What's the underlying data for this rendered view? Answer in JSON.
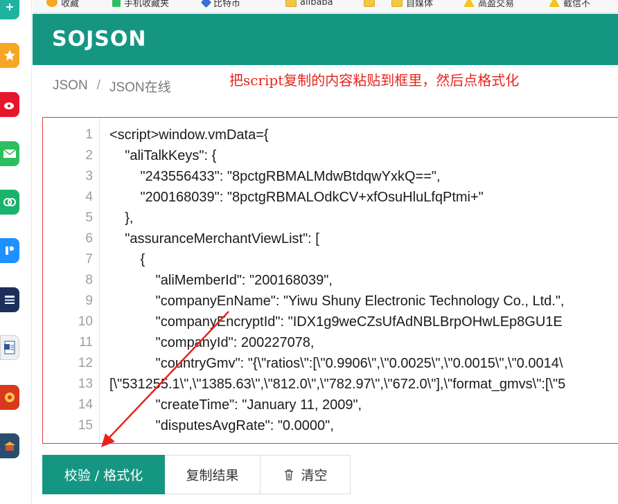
{
  "bookmarks": [
    {
      "label": "收藏",
      "icon": "star-icon"
    },
    {
      "label": "手机收藏夹",
      "icon": "folder-icon"
    },
    {
      "label": "比特币",
      "icon": "folder-icon"
    },
    {
      "label": "alibaba",
      "icon": "folder-icon"
    },
    {
      "label": "",
      "icon": "folder-icon"
    },
    {
      "label": "自媒体",
      "icon": "folder-icon"
    },
    {
      "label": "高盈交易",
      "icon": "warning-icon"
    },
    {
      "label": "截信不",
      "icon": "warning-icon"
    }
  ],
  "header": {
    "logo": "SOJSON",
    "color": "#159683"
  },
  "breadcrumb": {
    "items": [
      "JSON",
      "JSON在线"
    ],
    "separator": "/"
  },
  "annotation": "把script复制的内容粘贴到框里，然后点格式化",
  "editor": {
    "line_numbers": [
      "1",
      "2",
      "3",
      "4",
      "5",
      "6",
      "7",
      "8",
      "9",
      "10",
      "11",
      "12",
      "13",
      "14",
      "15"
    ],
    "lines": [
      "<script>window.vmData={",
      "    \"aliTalkKeys\": {",
      "        \"243556433\": \"8pctgRBMALMdwBtdqwYxkQ==\",",
      "        \"200168039\": \"8pctgRBMALOdkCV+xfOsuHluLfqPtmi+\"",
      "    },",
      "    \"assuranceMerchantViewList\": [",
      "        {",
      "            \"aliMemberId\": \"200168039\",",
      "            \"companyEnName\": \"Yiwu Shuny Electronic Technology Co., Ltd.\",",
      "            \"companyEncryptId\": \"IDX1g9weCZsUfAdNBLBrpOHwLEp8GU1E",
      "            \"companyId\": 200227078,",
      "            \"countryGmv\": \"{\\\"ratios\\\":[\\\"0.9906\\\",\\\"0.0025\\\",\\\"0.0015\\\",\\\"0.0014\\",
      "[\\\"531255.1\\\",\\\"1385.63\\\",\\\"812.0\\\",\\\"782.97\\\",\\\"672.0\\\"],\\\"format_gmvs\\\":[\\\"5",
      "            \"createTime\": \"January 11, 2009\",",
      "            \"disputesAvgRate\": \"0.0000\","
    ],
    "border_color": "#e03a3a"
  },
  "buttons": {
    "validate_format": "校验 / 格式化",
    "copy_result": "复制结果",
    "clear": "清空"
  }
}
